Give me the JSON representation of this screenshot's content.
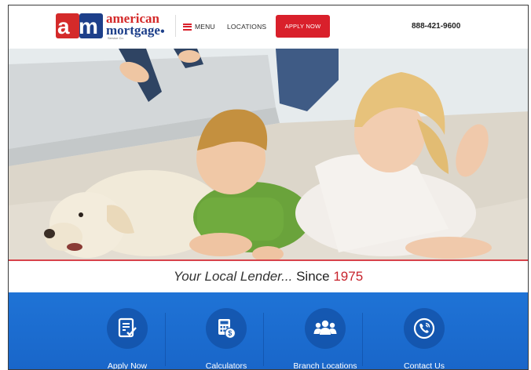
{
  "header": {
    "logo_mark_letters": "am",
    "logo_word1": "american",
    "logo_word2": "mortgage",
    "logo_small": "Service Co.",
    "menu_label": "MENU",
    "locations_label": "LOCATIONS",
    "apply_label": "APPLY NOW",
    "phone": "888-421-9600",
    "accent_color": "#d9202b",
    "brand_blue": "#1d3f8a"
  },
  "hero": {
    "slide_count": 4,
    "active_slide": 1
  },
  "tagline": {
    "part1": "Your Local Lender...",
    "part2": "Since",
    "year": "1975",
    "year_color": "#c7232c"
  },
  "services": {
    "bar_color": "#1f73d6",
    "items": [
      {
        "label": "Apply Now",
        "icon": "application-form-icon"
      },
      {
        "label": "Calculators",
        "icon": "calculator-icon"
      },
      {
        "label": "Branch Locations",
        "icon": "people-group-icon"
      },
      {
        "label": "Contact Us",
        "icon": "phone-icon"
      }
    ]
  }
}
